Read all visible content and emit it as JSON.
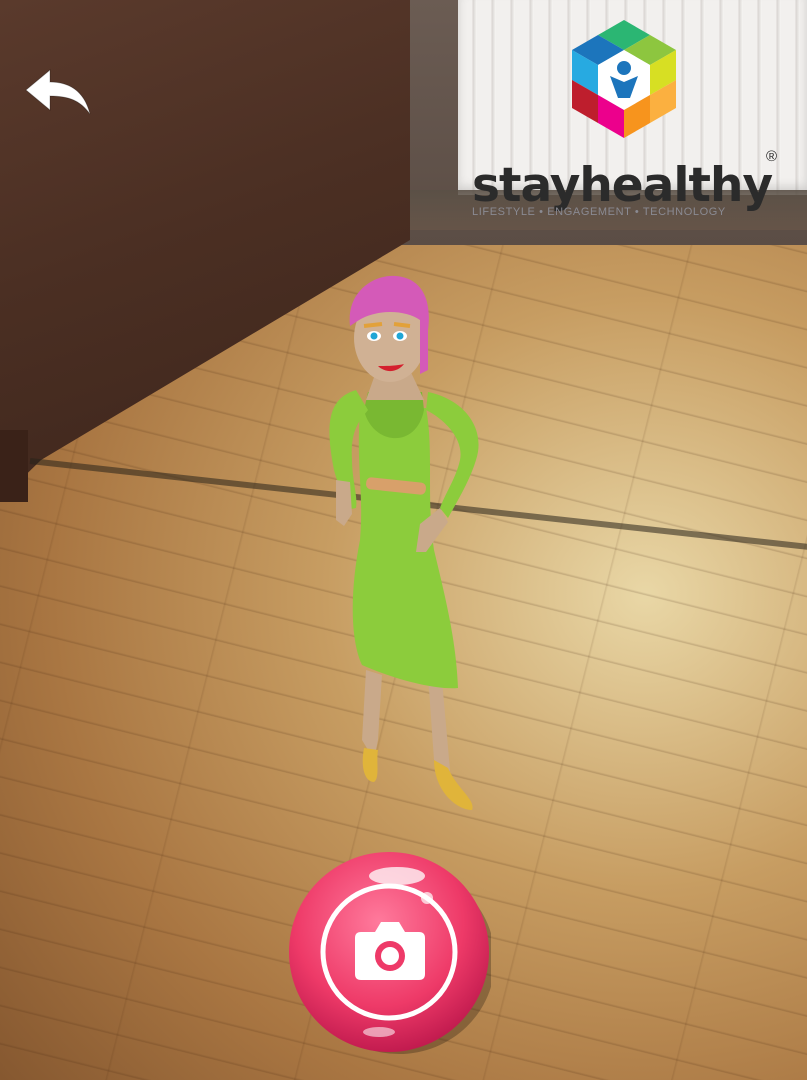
{
  "screen": {
    "background": "camera-feed-wood-floor-room"
  },
  "back_button": {
    "icon": "undo-arrow-icon",
    "color": "#ffffff"
  },
  "logo": {
    "wordmark": "stayhealthy",
    "registered": "®",
    "tagline": "LIFESTYLE • ENGAGEMENT • TECHNOLOGY"
  },
  "avatar": {
    "description_icon": "3d-avatar-woman",
    "dress_color": "#8ccc3c",
    "hair_color": "#d45ab8",
    "shoe_color": "#e0b43a"
  },
  "capture_button": {
    "icon": "camera-icon",
    "color": "#f2406e"
  }
}
